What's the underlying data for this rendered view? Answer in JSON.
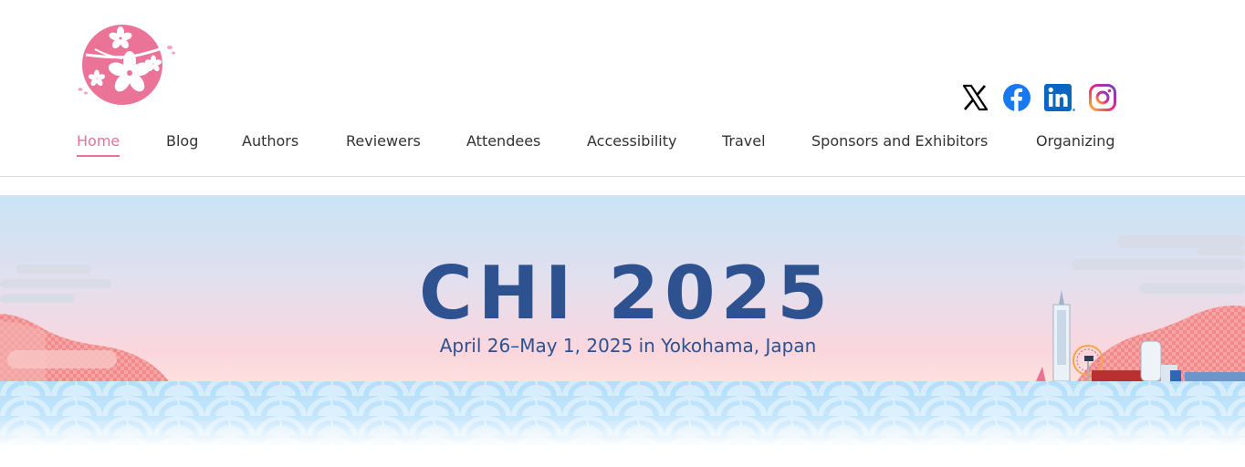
{
  "header": {
    "logo_name": "cherry-blossom-logo",
    "social": [
      {
        "name": "x-icon",
        "color": "#000000"
      },
      {
        "name": "facebook-icon",
        "color": "#1877f2"
      },
      {
        "name": "linkedin-icon",
        "color": "#0a66c2"
      },
      {
        "name": "instagram-icon",
        "color": "#d6249f"
      }
    ],
    "nav": [
      {
        "label": "Home",
        "active": true
      },
      {
        "label": "Blog"
      },
      {
        "label": "Authors"
      },
      {
        "label": "Reviewers"
      },
      {
        "label": "Attendees"
      },
      {
        "label": "Accessibility"
      },
      {
        "label": "Travel"
      },
      {
        "label": "Sponsors and Exhibitors"
      },
      {
        "label": "Organizing"
      }
    ]
  },
  "hero": {
    "title": "CHI 2025",
    "subtitle": "April 26–May 1, 2025 in Yokohama, Japan"
  },
  "colors": {
    "accent": "#e8719a",
    "title": "#2e5190",
    "sea": "#a9dbf7",
    "hill": "#f07e86"
  }
}
